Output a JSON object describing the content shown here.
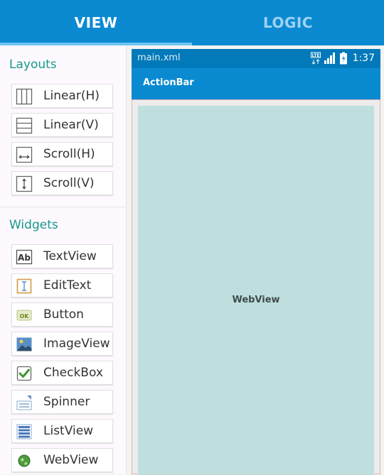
{
  "tabs": [
    {
      "label": "VIEW",
      "selected": true
    },
    {
      "label": "LOGIC",
      "selected": false
    }
  ],
  "palette": {
    "layouts_title": "Layouts",
    "layouts": [
      {
        "label": "Linear(H)",
        "icon": "linear-horizontal-icon"
      },
      {
        "label": "Linear(V)",
        "icon": "linear-vertical-icon"
      },
      {
        "label": "Scroll(H)",
        "icon": "scroll-horizontal-icon"
      },
      {
        "label": "Scroll(V)",
        "icon": "scroll-vertical-icon"
      }
    ],
    "widgets_title": "Widgets",
    "widgets": [
      {
        "label": "TextView",
        "icon": "textview-icon"
      },
      {
        "label": "EditText",
        "icon": "edittext-icon"
      },
      {
        "label": "Button",
        "icon": "button-ok-icon"
      },
      {
        "label": "ImageView",
        "icon": "image-icon"
      },
      {
        "label": "CheckBox",
        "icon": "checkbox-icon"
      },
      {
        "label": "Spinner",
        "icon": "spinner-icon"
      },
      {
        "label": "ListView",
        "icon": "listview-icon"
      },
      {
        "label": "WebView",
        "icon": "globe-icon"
      }
    ]
  },
  "preview": {
    "file_name": "main.xml",
    "network_label": "LTE",
    "time": "1:37",
    "action_bar_title": "ActionBar",
    "webview_label": "WebView"
  },
  "colors": {
    "primary": "#0b8ad1",
    "status_bar": "#0279b9",
    "section_title": "#16998a",
    "webview_fill": "#bedfde"
  }
}
